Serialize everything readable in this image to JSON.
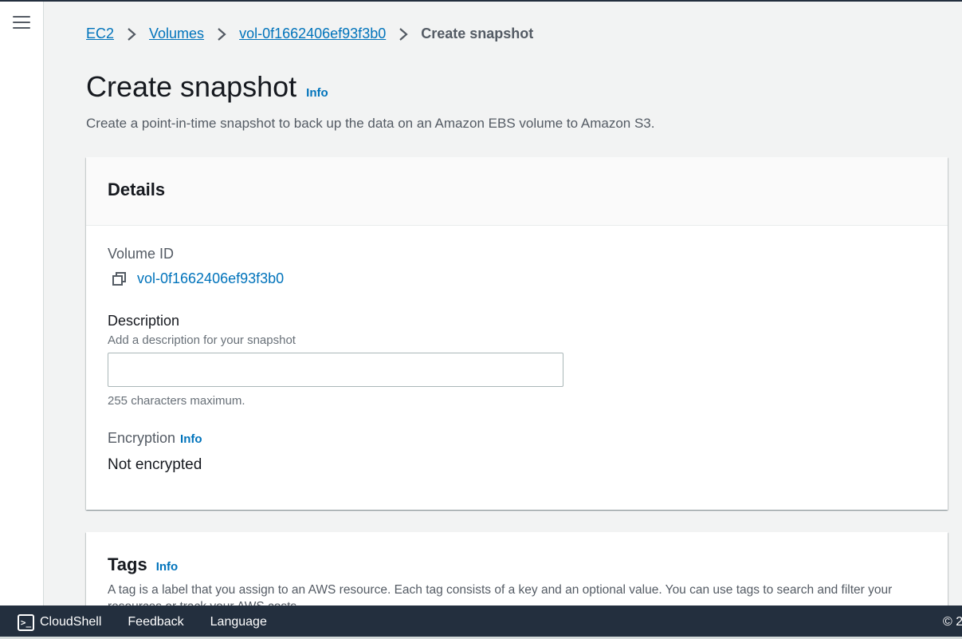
{
  "breadcrumb": {
    "items": [
      "EC2",
      "Volumes",
      "vol-0f1662406ef93f3b0"
    ],
    "current": "Create snapshot"
  },
  "page": {
    "title": "Create snapshot",
    "info": "Info",
    "description": "Create a point-in-time snapshot to back up the data on an Amazon EBS volume to Amazon S3."
  },
  "details": {
    "heading": "Details",
    "volume_id_label": "Volume ID",
    "volume_id_value": "vol-0f1662406ef93f3b0",
    "description_label": "Description",
    "description_hint": "Add a description for your snapshot",
    "description_value": "",
    "description_constraint": "255 characters maximum.",
    "encryption_label": "Encryption",
    "encryption_info": "Info",
    "encryption_value": "Not encrypted"
  },
  "tags": {
    "heading": "Tags",
    "info": "Info",
    "description": "A tag is a label that you assign to an AWS resource. Each tag consists of a key and an optional value. You can use tags to search and filter your resources or track your AWS costs."
  },
  "footer": {
    "cloudshell": "CloudShell",
    "cloudshell_icon_glyph": ">_",
    "feedback": "Feedback",
    "language": "Language",
    "copyright": "© 2"
  },
  "icons": {
    "menu": "hamburger-menu-icon",
    "breadcrumb_separator": "chevron-right-icon",
    "copy": "copy-icon",
    "cloudshell": "terminal-icon"
  },
  "colors": {
    "link": "#0073bb",
    "header_bg": "#232f3e",
    "page_bg": "#f2f3f3"
  }
}
